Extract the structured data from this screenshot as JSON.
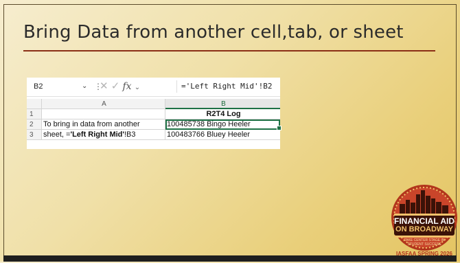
{
  "slide": {
    "title": "Bring Data from another cell,tab, or sheet"
  },
  "excel": {
    "name_box": "B2",
    "formula_icons": "✕ ✓",
    "fx": "fx",
    "formula": "='Left Right Mid'!B2",
    "col_headers": [
      "A",
      "B"
    ],
    "rows": [
      {
        "num": "1",
        "a": "",
        "b": "R2T4 Log"
      },
      {
        "num": "2",
        "a": "To bring in data from another",
        "b": "100485738 Bingo Heeler"
      },
      {
        "num": "3",
        "a_prefix": "sheet, =",
        "a_bold": "'Left Right Mid'",
        "a_suffix": "!B3",
        "b": "100483766 Bluey Heeler"
      }
    ]
  },
  "badge": {
    "line1": "FINANCIAL AID",
    "line2": "ON BROADWAY",
    "tagline1": "TAKE CENTER STAGE IN",
    "tagline2": "STUDENT SUCCESS",
    "footer": "IASFAA SPRING 2026"
  },
  "colors": {
    "title_rule": "#8a2e16",
    "excel_selection": "#1e7145",
    "badge_red": "#b2361c",
    "badge_dark": "#3b1208"
  }
}
